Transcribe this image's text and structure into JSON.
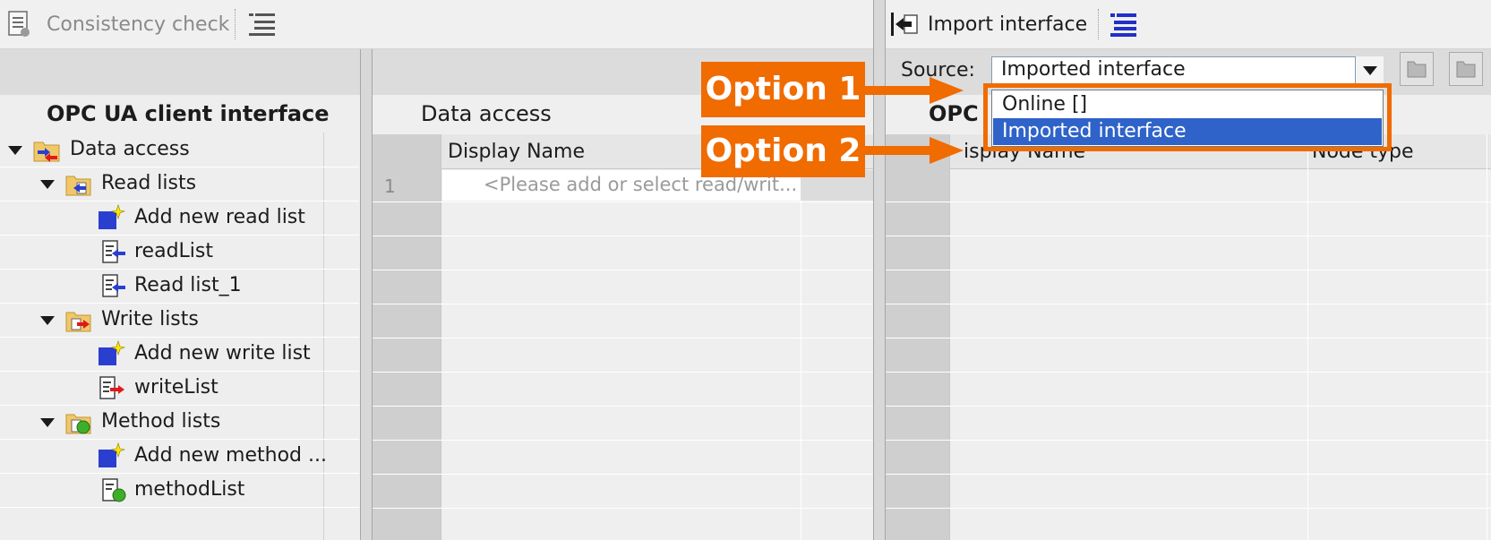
{
  "toolbar": {
    "consistency_check": "Consistency check",
    "import_interface": "Import interface"
  },
  "source": {
    "label": "Source:",
    "selected": "Imported interface",
    "options": [
      "Online []",
      "Imported interface"
    ]
  },
  "left_panel": {
    "title": "OPC UA client interface",
    "tree": [
      {
        "label": "Data access"
      },
      {
        "label": "Read lists"
      },
      {
        "label": "Add new read list"
      },
      {
        "label": "readList"
      },
      {
        "label": "Read list_1"
      },
      {
        "label": "Write lists"
      },
      {
        "label": "Add new write list"
      },
      {
        "label": "writeList"
      },
      {
        "label": "Method lists"
      },
      {
        "label": "Add new method ..."
      },
      {
        "label": "methodList"
      }
    ]
  },
  "center_panel": {
    "title": "Data access",
    "column_display_name": "Display Name",
    "first_row_number": "1",
    "placeholder": "<Please add or select read/writ..."
  },
  "right_panel": {
    "title_visible": "OPC",
    "column_display_name": "isplay Name",
    "column_node_type": "Node type"
  },
  "callouts": {
    "option1": "Option 1",
    "option2": "Option 2"
  },
  "colors": {
    "accent_orange": "#f06b00",
    "selection_blue": "#2f63c9"
  }
}
